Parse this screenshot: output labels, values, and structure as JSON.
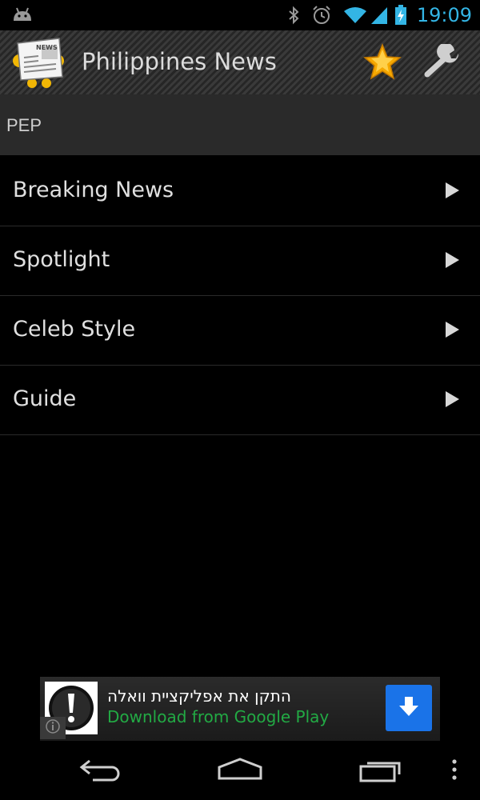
{
  "status_bar": {
    "time": "19:09",
    "icons": [
      "android-icon",
      "bluetooth-icon",
      "alarm-icon",
      "wifi-icon",
      "signal-icon",
      "battery-charging-icon"
    ],
    "time_color": "#33b5e5"
  },
  "action_bar": {
    "title": "Philippines News",
    "logo_icon": "newspaper-mascot-icon",
    "logo_text": "NEWS",
    "actions": [
      "star-icon",
      "wrench-icon"
    ]
  },
  "section": {
    "title": "PEP"
  },
  "menu": {
    "items": [
      {
        "label": "Breaking News"
      },
      {
        "label": "Spotlight"
      },
      {
        "label": "Celeb Style"
      },
      {
        "label": "Guide"
      }
    ]
  },
  "ad": {
    "title": "התקן את אפליקציית וואלה",
    "subtitle": "Download from Google Play",
    "subtitle_color": "#22aa44",
    "button_color": "#1a73e8"
  },
  "nav_bar": {
    "buttons": [
      "back-icon",
      "home-icon",
      "recents-icon",
      "overflow-menu-icon"
    ]
  }
}
